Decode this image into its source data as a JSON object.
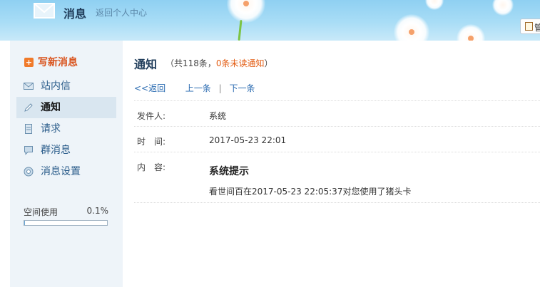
{
  "header": {
    "title": "消息",
    "back_link": "返回个人中心",
    "corner_button_glyph": "管"
  },
  "sidebar": {
    "compose_label": "写新消息",
    "items": [
      {
        "label": "站内信",
        "icon": "envelope-icon"
      },
      {
        "label": "通知",
        "icon": "pencil-icon",
        "active": true
      },
      {
        "label": "请求",
        "icon": "document-icon"
      },
      {
        "label": "群消息",
        "icon": "speech-bubble-icon"
      },
      {
        "label": "消息设置",
        "icon": "settings-circle-icon"
      }
    ],
    "usage": {
      "label": "空间使用",
      "value": "0.1%",
      "fraction": 0.001
    }
  },
  "main": {
    "title": "通知",
    "count_prefix": "（共118条，",
    "unread_text": "0条未读通知",
    "count_suffix": "）",
    "nav": {
      "back": "<<返回",
      "prev": "上一条",
      "separator": "|",
      "next": "下一条"
    },
    "fields": {
      "sender_label": "发件人:",
      "sender_value": "系统",
      "time_label": "时　间:",
      "time_value": "2017-05-23 22:01",
      "content_label": "内　容:"
    },
    "message": {
      "title": "系统提示",
      "body": "看世间百在2017-05-23 22:05:37对您使用了猪头卡"
    }
  },
  "colors": {
    "accent": "#e35d14",
    "link": "#2a6bb1",
    "sidebar_bg": "#eef4f9",
    "active_bg": "#d9e6f0"
  }
}
